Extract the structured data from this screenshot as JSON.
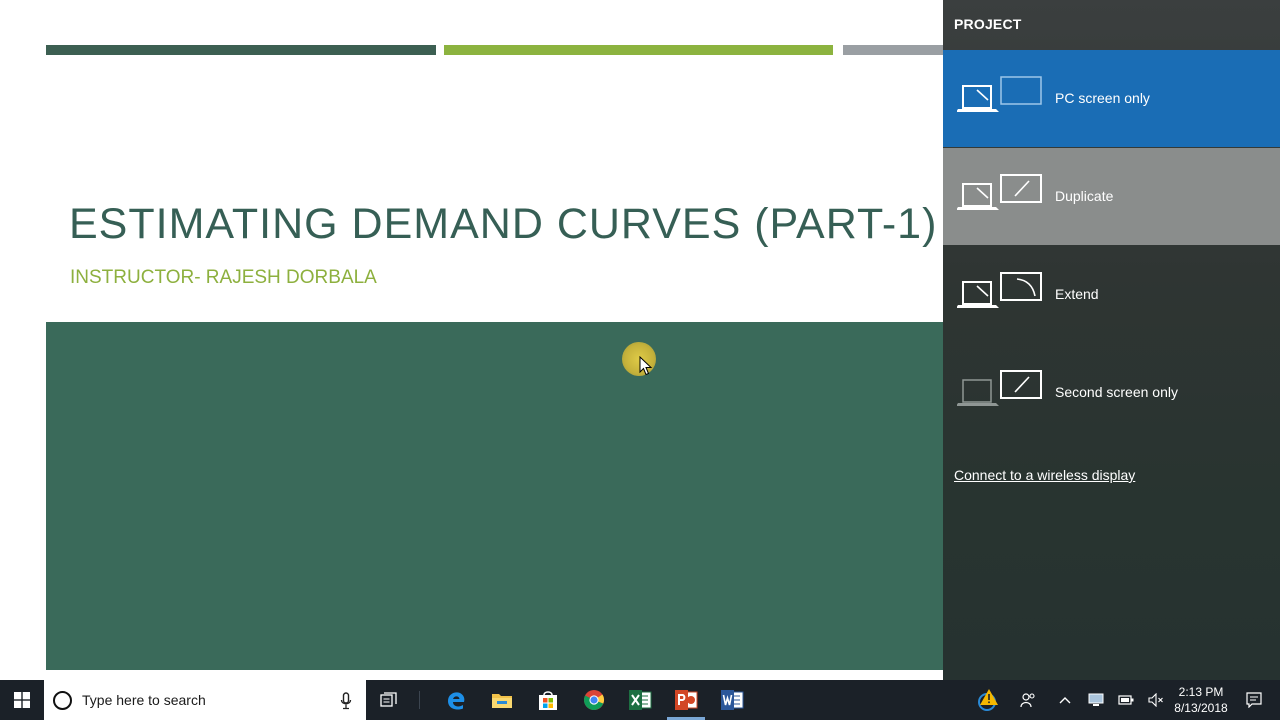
{
  "slide": {
    "title": "ESTIMATING DEMAND CURVES (PART-1)",
    "subtitle": "INSTRUCTOR- RAJESH DORBALA",
    "colors": {
      "dark_green": "#3c5f52",
      "light_green": "#8cb33f",
      "gray": "#9a9fa3",
      "panel": "#3a6a5a"
    }
  },
  "project": {
    "heading": "PROJECT",
    "options": [
      {
        "label": "PC screen only",
        "icon": "pc-screen-only-icon",
        "state": "selected"
      },
      {
        "label": "Duplicate",
        "icon": "duplicate-icon",
        "state": "hovered"
      },
      {
        "label": "Extend",
        "icon": "extend-icon",
        "state": "normal"
      },
      {
        "label": "Second screen only",
        "icon": "second-screen-only-icon",
        "state": "normal"
      }
    ],
    "wireless_link": "Connect to a wireless display",
    "accent": "#1a6db5"
  },
  "taskbar": {
    "search_placeholder": "Type here to search",
    "apps": [
      "task-view-icon",
      "edge-icon",
      "file-explorer-icon",
      "store-icon",
      "chrome-icon",
      "excel-icon",
      "powerpoint-icon",
      "word-icon"
    ],
    "time": "2:13 PM",
    "date": "8/13/2018"
  }
}
